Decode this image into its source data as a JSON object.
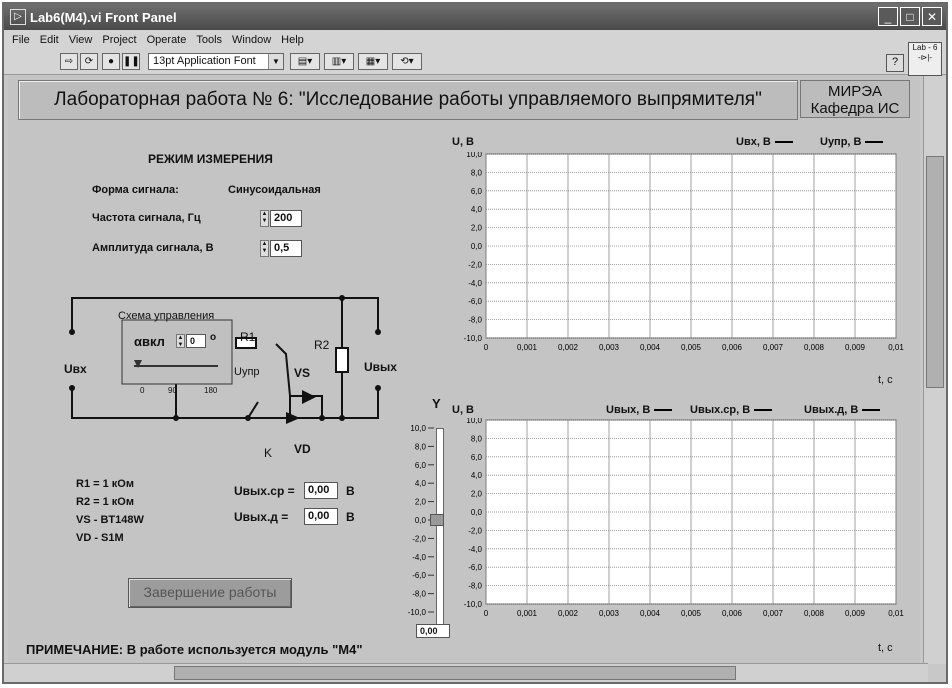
{
  "window": {
    "title": "Lab6(M4).vi Front Panel"
  },
  "menu": [
    "File",
    "Edit",
    "View",
    "Project",
    "Operate",
    "Tools",
    "Window",
    "Help"
  ],
  "toolbar": {
    "font": "13pt Application Font",
    "lab_icon": "Lab - 6"
  },
  "banner": {
    "title": "Лабораторная работа № 6: \"Исследование работы управляемого выпрямителя\"",
    "org1": "МИРЭА",
    "org2": "Кафедра ИС"
  },
  "mode": {
    "heading": "РЕЖИМ ИЗМЕРЕНИЯ",
    "shape_label": "Форма сигнала:",
    "shape_value": "Синусоидальная",
    "freq_label": "Частота сигнала, Гц",
    "freq_value": "200",
    "amp_label": "Амплитуда сигнала, В",
    "amp_value": "0,5"
  },
  "schema": {
    "title": "Схема управления",
    "alpha_label": "αвкл",
    "alpha_value": "0",
    "alpha_unit": "o",
    "scale": [
      "0",
      "90",
      "180"
    ],
    "r1": "R1",
    "r2": "R2",
    "vs": "VS",
    "vd": "VD",
    "k": "K",
    "uvx": "Uвх",
    "uvyx": "Uвых",
    "uupr": "Uупр"
  },
  "components": [
    "R1 = 1 кОм",
    "R2 = 1 кОм",
    "VS - BT148W",
    "VD - S1M"
  ],
  "meas": {
    "avg_label": "Uвых.ср =",
    "avg_value": "0,00",
    "avg_unit": "В",
    "eff_label": "Uвых.д =",
    "eff_value": "0,00",
    "eff_unit": "В"
  },
  "finish_button": "Завершение работы",
  "note": "ПРИМЕЧАНИЕ: В работе используется модуль \"М4\"",
  "graph1": {
    "ylabel": "U, В",
    "legend": [
      "Uвх, В",
      "Uупр, В"
    ],
    "xlabel": "t, c"
  },
  "graph2": {
    "ylabel": "U, В",
    "legend": [
      "Uвых, В",
      "Uвых.ср, В",
      "Uвых.д, В"
    ],
    "xlabel": "t, c"
  },
  "slider": {
    "label": "Y",
    "value": "0,00"
  },
  "chart_data": [
    {
      "type": "line",
      "x": [],
      "series": [],
      "xlim": [
        0,
        0.01
      ],
      "ylim": [
        -10,
        10
      ],
      "xticks": [
        "0",
        "0,001",
        "0,002",
        "0,003",
        "0,004",
        "0,005",
        "0,006",
        "0,007",
        "0,008",
        "0,009",
        "0,01"
      ],
      "yticks": [
        "10,0",
        "8,0",
        "6,0",
        "4,0",
        "2,0",
        "0,0",
        "-2,0",
        "-4,0",
        "-6,0",
        "-8,0",
        "-10,0"
      ],
      "grid": true
    },
    {
      "type": "line",
      "x": [],
      "series": [],
      "xlim": [
        0,
        0.01
      ],
      "ylim": [
        -10,
        10
      ],
      "xticks": [
        "0",
        "0,001",
        "0,002",
        "0,003",
        "0,004",
        "0,005",
        "0,006",
        "0,007",
        "0,008",
        "0,009",
        "0,01"
      ],
      "yticks": [
        "10,0",
        "8,0",
        "6,0",
        "4,0",
        "2,0",
        "0,0",
        "-2,0",
        "-4,0",
        "-6,0",
        "-8,0",
        "-10,0"
      ],
      "grid": true
    }
  ]
}
